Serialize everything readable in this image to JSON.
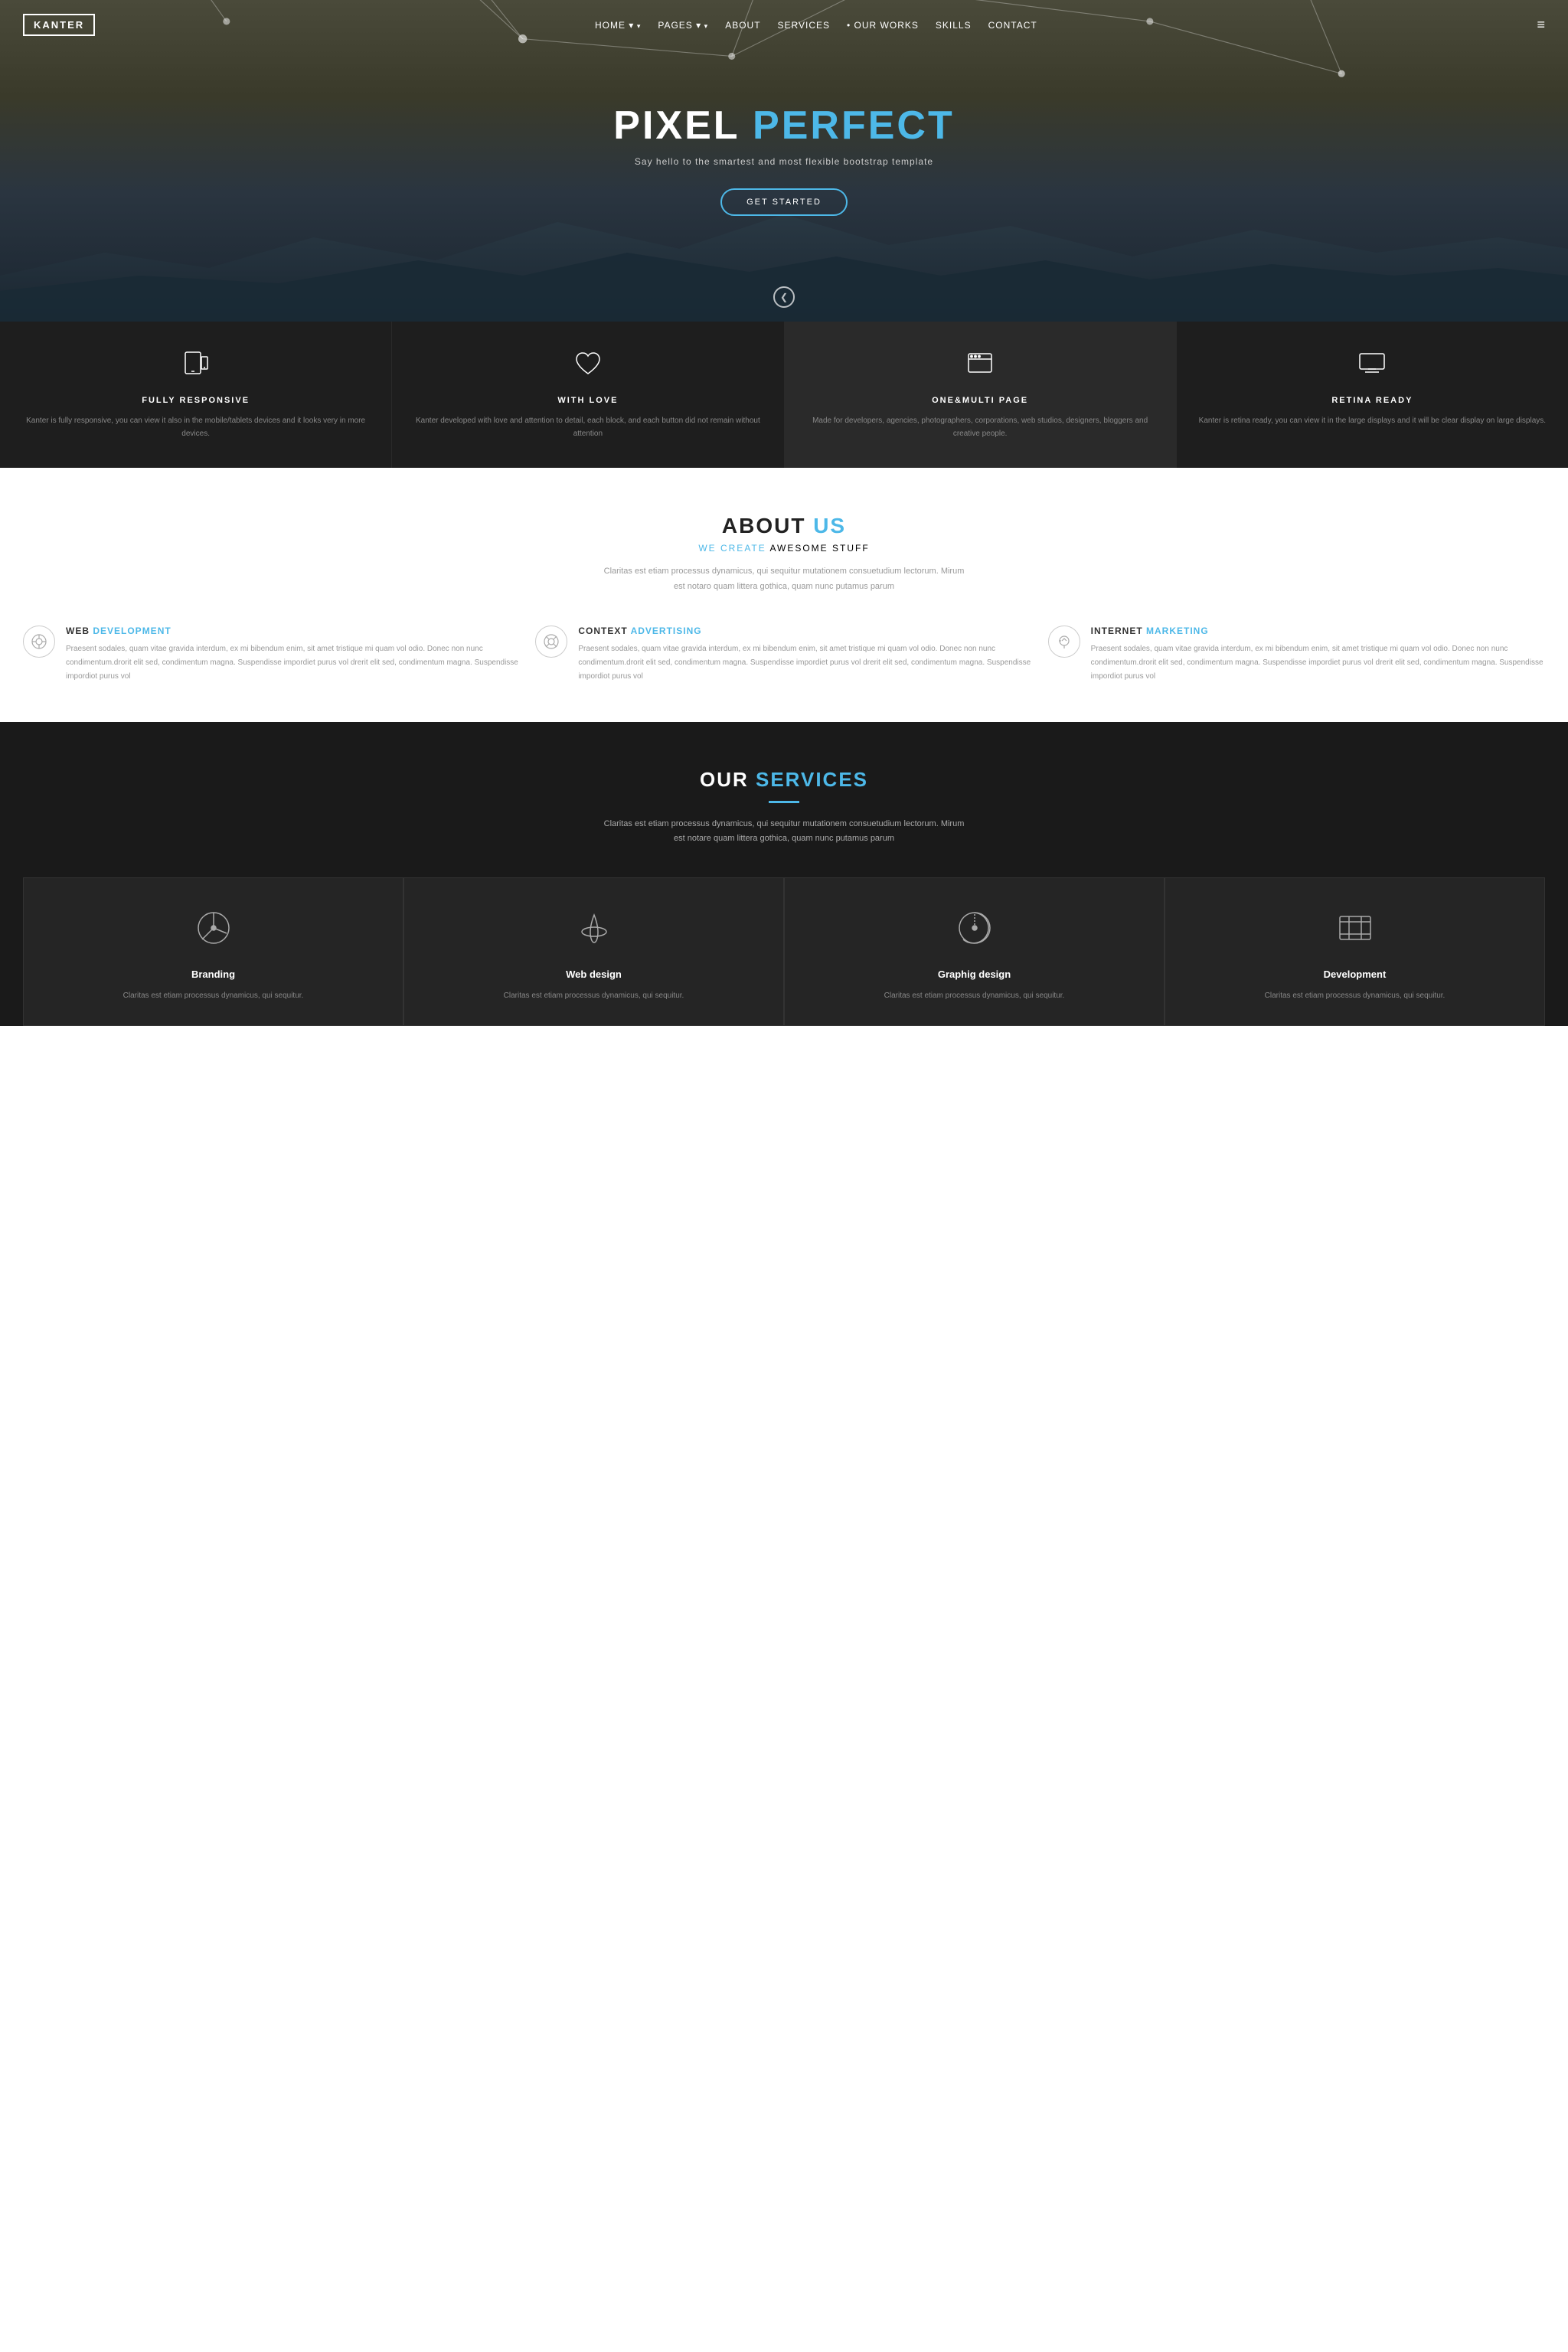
{
  "brand": {
    "logo": "KANTER"
  },
  "navbar": {
    "links": [
      {
        "label": "HOME",
        "has_dropdown": true
      },
      {
        "label": "PAGES",
        "has_dropdown": true
      },
      {
        "label": "ABOUT",
        "has_dropdown": false
      },
      {
        "label": "SERVICES",
        "has_dropdown": false
      },
      {
        "label": "OUR WORKS",
        "has_dropdown": false
      },
      {
        "label": "SKILLS",
        "has_dropdown": false
      },
      {
        "label": "CONTACT",
        "has_dropdown": false
      }
    ]
  },
  "hero": {
    "title_part1": "PIXEL ",
    "title_part2": "PERFECT",
    "subtitle": "Say hello to the smartest and most flexible bootstrap template",
    "btn_label": "GET STARTED",
    "arrow": "❯"
  },
  "features": [
    {
      "title": "FULLY RESPONSIVE",
      "desc": "Kanter is fully responsive, you can view it also in the mobile/tablets devices and it looks very in more devices.",
      "icon": "📱"
    },
    {
      "title": "WITH LOVE",
      "desc": "Kanter developed with love and attention to detail, each block, and each button did not remain without attention",
      "icon": "♡"
    },
    {
      "title": "ONE&MULTI PAGE",
      "desc": "Made for developers, agencies, photographers, corporations, web studios, designers, bloggers and creative people.",
      "icon": "⬜"
    },
    {
      "title": "RETINA READY",
      "desc": "Kanter is retina ready, you can view it in the large displays and it will be clear display on large displays.",
      "icon": "🖥"
    }
  ],
  "about": {
    "title_part1": "ABOUT ",
    "title_part2": "US",
    "subtitle_part1": "WE CREATE ",
    "subtitle_part2": "AWESOME STUFF",
    "desc": "Claritas est etiam processus dynamicus, qui sequitur mutationem consuetudium lectorum. Mirum est notaro quam littera gothica, quam nunc putamus parum",
    "features": [
      {
        "title_part1": "WEB ",
        "title_part2": "DEVELOPMENT",
        "desc": "Praesent sodales, quam vitae gravida interdum, ex mi bibendum enim, sit amet tristique mi quam vol odio. Donec non nunc condimentum.drorit elit sed, condimentum magna. Suspendisse impordiet purus vol drerit elit sed, condimentum magna. Suspendisse impordiot purus vol",
        "icon": "◎"
      },
      {
        "title_part1": "CONTEXT ",
        "title_part2": "ADVERTISING",
        "desc": "Praesent sodales, quam vitae gravida interdum, ex mi bibendum enim, sit amet tristique mi quam vol odio. Donec non nunc condimentum.drorit elit sed, condimentum magna. Suspendisse impordiet purus vol drerit elit sed, condimentum magna. Suspendisse impordiot purus vol",
        "icon": "⊙"
      },
      {
        "title_part1": "INTERNET ",
        "title_part2": "MARKETING",
        "desc": "Praesent sodales, quam vitae gravida interdum, ex mi bibendum enim, sit amet tristique mi quam vol odio. Donec non nunc condimentum.drorit elit sed, condimentum magna. Suspendisse impordiet purus vol drerit elit sed, condimentum magna. Suspendisse impordiot purus vol",
        "icon": "💡"
      }
    ]
  },
  "services": {
    "title_part1": "OUR ",
    "title_part2": "SERVICES",
    "desc": "Claritas est etiam processus dynamicus, qui sequitur mutationem consuetudium lectorum. Mirum est notare quam littera gothica, quam nunc putamus parum",
    "cards": [
      {
        "title": "Branding",
        "desc": "Claritas est etiam processus dynamicus, qui sequitur.",
        "icon": "◔"
      },
      {
        "title": "Web design",
        "desc": "Claritas est etiam processus dynamicus, qui sequitur.",
        "icon": "💧"
      },
      {
        "title": "Graphig design",
        "desc": "Claritas est etiam processus dynamicus, qui sequitur.",
        "icon": "◷"
      },
      {
        "title": "Development",
        "desc": "Claritas est etiam processus dynamicus, qui sequitur.",
        "icon": "🗺"
      }
    ]
  }
}
